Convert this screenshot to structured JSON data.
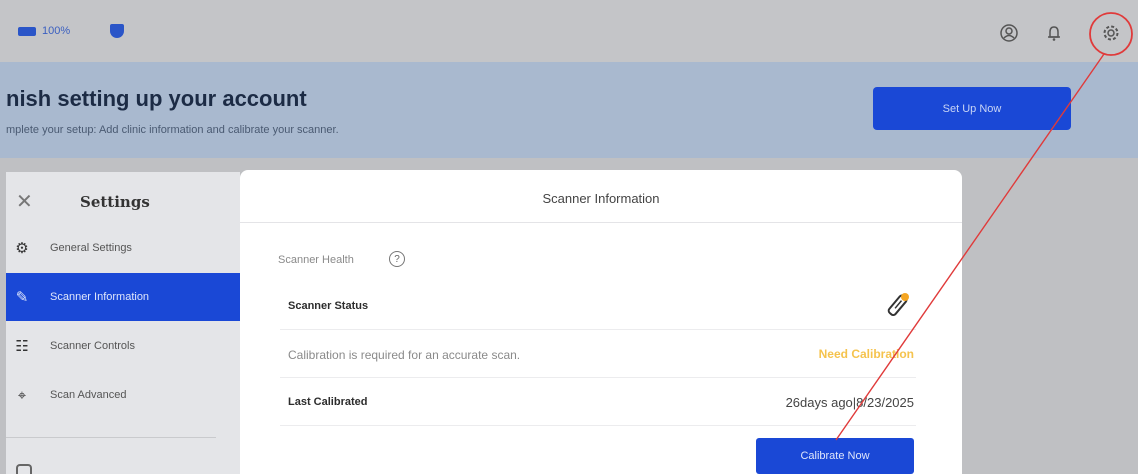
{
  "topbar": {
    "battery_pct": "100%",
    "icons": [
      "battery-icon",
      "shield-icon",
      "account-icon",
      "bell-icon",
      "gear-icon"
    ]
  },
  "banner": {
    "title": "nish setting up your account",
    "subtitle": "mplete your setup: Add clinic information and calibrate your scanner.",
    "button_label": "Set Up Now"
  },
  "settings": {
    "title": "Settings",
    "items": [
      {
        "label": "General Settings",
        "icon": "general-settings-icon",
        "active": false
      },
      {
        "label": "Scanner Information",
        "icon": "scanner-icon",
        "active": true
      },
      {
        "label": "Scanner Controls",
        "icon": "sliders-icon",
        "active": false
      },
      {
        "label": "Scan Advanced",
        "icon": "scan-advanced-icon",
        "active": false
      }
    ]
  },
  "main": {
    "title": "Scanner Information",
    "health_label": "Scanner Health",
    "help_glyph": "?",
    "rows": [
      {
        "label": "Scanner Status",
        "value": ""
      },
      {
        "label": "Calibration is required for an accurate scan.",
        "value": "Need Calibration"
      },
      {
        "label": "Last Calibrated",
        "value": "26days ago|8/23/2025"
      }
    ],
    "calibrate_label": "Calibrate Now"
  },
  "colors": {
    "accent": "#1a48d6",
    "warning": "#f5c34d",
    "annotation": "#e03a3a"
  }
}
